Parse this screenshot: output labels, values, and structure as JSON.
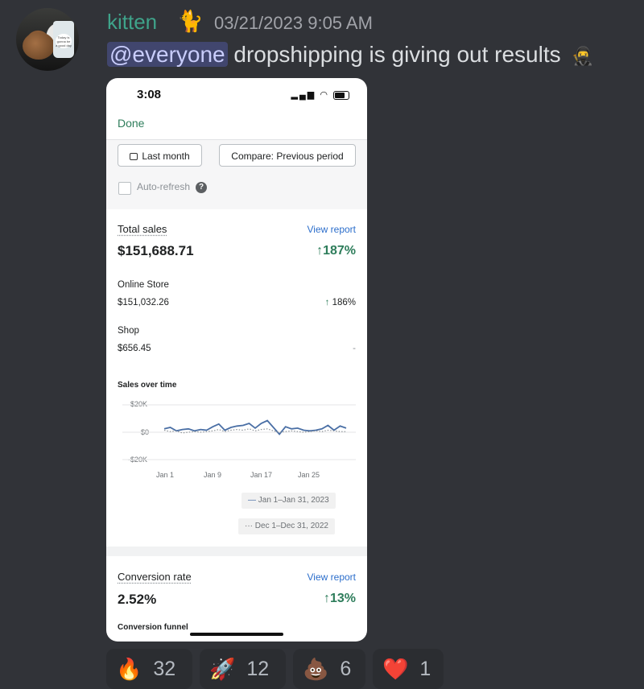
{
  "message": {
    "username": "kitten",
    "username_emoji": "🐈",
    "timestamp": "03/21/2023 9:05 AM",
    "mention": "@everyone",
    "text": "dropshipping is giving out results",
    "trailing_emoji": "🥷"
  },
  "avatar": {
    "cup_text": "Today is gonna be a good day"
  },
  "screenshot": {
    "status_time": "3:08",
    "done_label": "Done",
    "filter_period": "Last month",
    "filter_compare": "Compare: Previous period",
    "auto_refresh_label": "Auto-refresh",
    "help_icon_text": "?",
    "total_sales": {
      "title": "Total sales",
      "view_report": "View report",
      "value": "$151,688.71",
      "change": "↑187%"
    },
    "channels": [
      {
        "name": "Online Store",
        "value": "$151,032.26",
        "change": "186%"
      },
      {
        "name": "Shop",
        "value": "$656.45",
        "change": "-"
      }
    ],
    "chart_data": {
      "type": "line",
      "title": "Sales over time",
      "y_ticks": [
        "$20K",
        "$0",
        "-$20K"
      ],
      "x_ticks": [
        "Jan 1",
        "Jan 9",
        "Jan 17",
        "Jan 25"
      ],
      "ylim": [
        -20000,
        20000
      ],
      "series": [
        {
          "name": "Jan 1–Jan 31, 2023",
          "style": "solid",
          "color": "#4a6fa5",
          "values": [
            2500,
            3500,
            1000,
            2000,
            2500,
            1000,
            2000,
            1500,
            4000,
            6000,
            1500,
            3500,
            4500,
            5000,
            6500,
            3000,
            6500,
            8500,
            3500,
            -1500,
            4000,
            2500,
            3000,
            1500,
            1000,
            1500,
            2500,
            5000,
            1500,
            4500,
            3000
          ]
        },
        {
          "name": "Dec 1–Dec 31, 2022",
          "style": "dotted",
          "color": "#8c9196",
          "values": [
            1500,
            500,
            1000,
            -500,
            0,
            500,
            0,
            500,
            1000,
            2000,
            500,
            1500,
            2000,
            1500,
            2500,
            1000,
            2000,
            2500,
            1000,
            0,
            500,
            1000,
            500,
            0,
            500,
            1000,
            500,
            1500,
            1000,
            500,
            500
          ]
        }
      ]
    },
    "conversion": {
      "title": "Conversion rate",
      "view_report": "View report",
      "value": "2.52%",
      "change": "↑13%",
      "funnel_label": "Conversion funnel"
    }
  },
  "reactions": [
    {
      "emoji": "🔥",
      "count": "32"
    },
    {
      "emoji": "🚀",
      "count": "12"
    },
    {
      "emoji": "💩",
      "count": "6"
    },
    {
      "emoji": "❤️",
      "count": "1"
    }
  ],
  "colors": {
    "background": "#313338",
    "username": "#3fa38a",
    "mention_bg": "#41466e",
    "positive": "#2e7d5b",
    "link": "#2c6ecb"
  }
}
